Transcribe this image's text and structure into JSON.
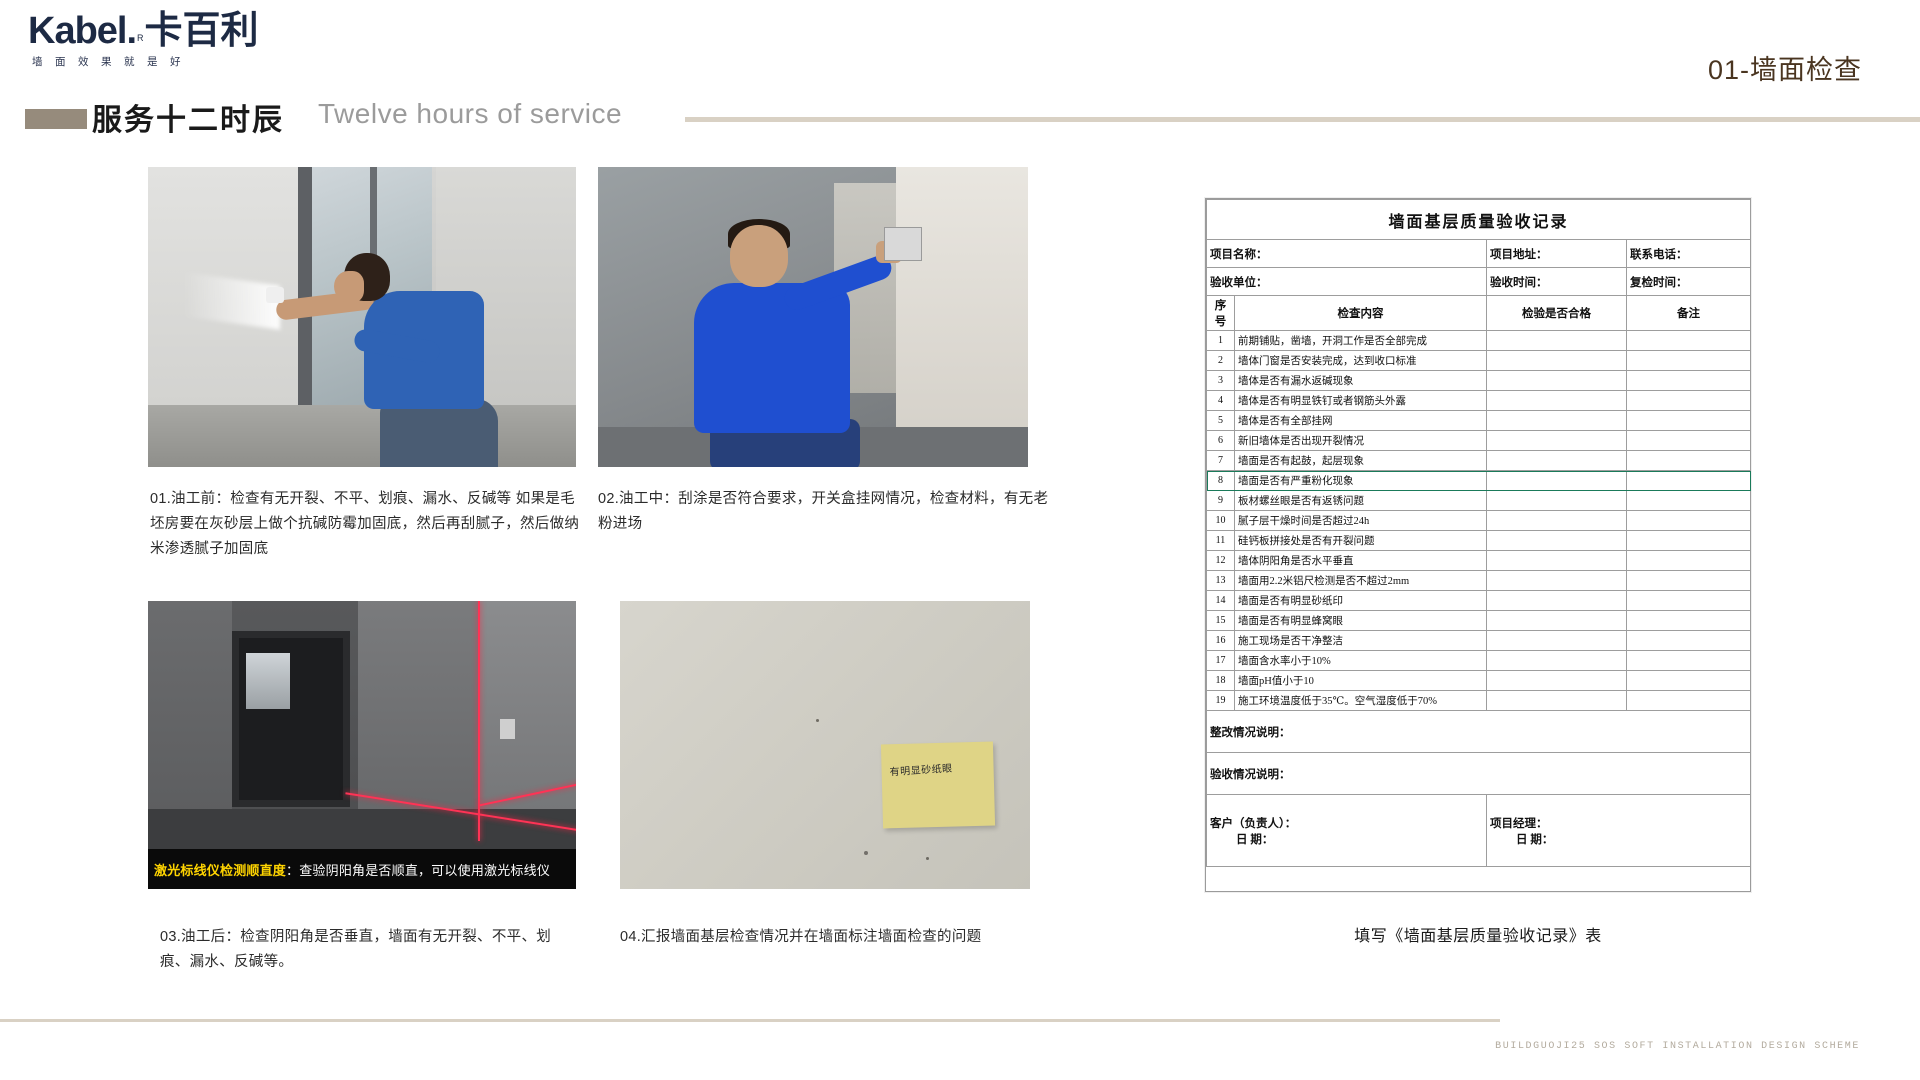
{
  "brand": {
    "name_en": "Kabel",
    "trademark": "R",
    "name_cn": "卡百利",
    "tagline": "墙面效果就是好"
  },
  "header": {
    "page_title": "01-墙面检查",
    "section_cn": "服务十二时辰",
    "section_en": "Twelve hours of service",
    "accent_color": "#968b7c",
    "title_color": "#4a3520"
  },
  "photos": [
    {
      "id": "photo-inspect-before",
      "caption": "01.油工前：检查有无开裂、不平、划痕、漏水、反碱等 如果是毛坯房要在灰砂层上做个抗碱防霉加固底，然后再刮腻子，然后做纳米渗透腻子加固底"
    },
    {
      "id": "photo-inspect-during",
      "caption": "02.油工中：刮涂是否符合要求，开关盒挂网情况，检查材料，有无老粉进场"
    },
    {
      "id": "photo-laser-level",
      "caption": "03.油工后：检查阴阳角是否垂直，墙面有无开裂、不平、划痕、漏水、反碱等。",
      "overlay_highlight": "激光标线仪检测顺直度",
      "overlay_rest": "：查验阴阳角是否顺直，可以使用激光标线仪"
    },
    {
      "id": "photo-wall-marking",
      "caption": "04.汇报墙面基层检查情况并在墙面标注墙面检查的问题",
      "sticky_note": "有明显砂纸眼"
    }
  ],
  "form": {
    "title": "墙面基层质量验收记录",
    "info_row_1": [
      "项目名称：",
      "项目地址：",
      "联系电话："
    ],
    "info_row_2": [
      "验收单位：",
      "验收时间：",
      "复检时间："
    ],
    "columns": [
      "序号",
      "检查内容",
      "检验是否合格",
      "备注"
    ],
    "rows": [
      {
        "no": "1",
        "item": "前期铺贴，凿墙，开洞工作是否全部完成"
      },
      {
        "no": "2",
        "item": "墙体门窗是否安装完成，达到收口标准"
      },
      {
        "no": "3",
        "item": "墙体是否有漏水返碱现象"
      },
      {
        "no": "4",
        "item": "墙体是否有明显铁钉或者钢筋头外露"
      },
      {
        "no": "5",
        "item": "墙体是否有全部挂网"
      },
      {
        "no": "6",
        "item": "新旧墙体是否出现开裂情况"
      },
      {
        "no": "7",
        "item": "墙面是否有起鼓，起层现象"
      },
      {
        "no": "8",
        "item": "墙面是否有严重粉化现象"
      },
      {
        "no": "9",
        "item": "板材螺丝眼是否有返锈问题"
      },
      {
        "no": "10",
        "item": "腻子层干燥时间是否超过24h"
      },
      {
        "no": "11",
        "item": "硅钙板拼接处是否有开裂问题"
      },
      {
        "no": "12",
        "item": "墙体阴阳角是否水平垂直"
      },
      {
        "no": "13",
        "item": "墙面用2.2米铝尺检测是否不超过2mm"
      },
      {
        "no": "14",
        "item": "墙面是否有明显砂纸印"
      },
      {
        "no": "15",
        "item": "墙面是否有明显蜂窝眼"
      },
      {
        "no": "16",
        "item": "施工现场是否干净整洁"
      },
      {
        "no": "17",
        "item": "墙面含水率小于10%"
      },
      {
        "no": "18",
        "item": "墙面pH值小于10"
      },
      {
        "no": "19",
        "item": "施工环境温度低于35℃。空气湿度低于70%"
      }
    ],
    "rectify_label": "整改情况说明：",
    "acceptance_label": "验收情况说明：",
    "sign_customer": "客户（负责人）：",
    "sign_customer_date": "日    期：",
    "sign_manager": "项目经理：",
    "sign_manager_date": "日    期：",
    "caption": "填写《墙面基层质量验收记录》表"
  },
  "footer": {
    "text": "BUILDGUOJI25 SOS SOFT INSTALLATION DESIGN SCHEME"
  }
}
